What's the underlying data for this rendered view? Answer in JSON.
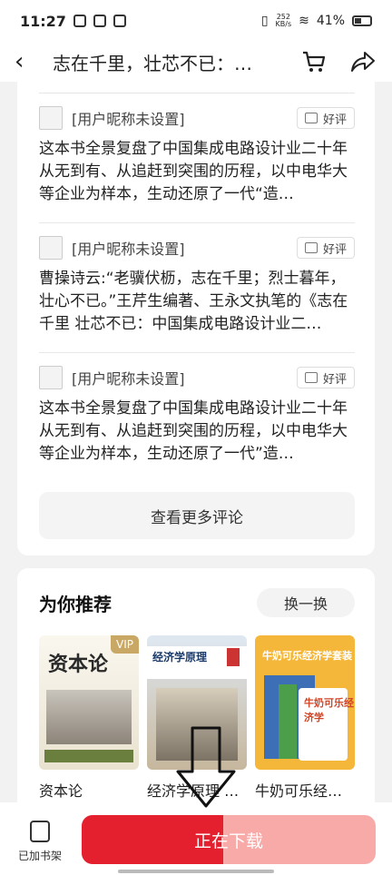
{
  "status_bar": {
    "time": "11:27",
    "net_speed_top": "252",
    "net_speed_bottom": "KB/s",
    "battery": "41%"
  },
  "nav": {
    "title": "志在千里，壮芯不已：…",
    "icons": {
      "back": "back-chevron-icon",
      "cart": "cart-icon",
      "share": "share-icon"
    }
  },
  "comments": [
    {
      "user": "[用户昵称未设置]",
      "badge": "好评",
      "text": "这本书全景复盘了中国集成电路设计业二十年从无到有、从追赶到突围的历程，以中电华大等企业为样本，生动还原了一代“造…"
    },
    {
      "user": "[用户昵称未设置]",
      "badge": "好评",
      "text": "曹操诗云:“老骥伏枥，志在千里；烈士暮年，壮心不已。”王芹生编著、王永文执笔的《志在千里 壮芯不已：中国集成电路设计业二…"
    },
    {
      "user": "[用户昵称未设置]",
      "badge": "好评",
      "text": "这本书全景复盘了中国集成电路设计业二十年从无到有、从追赶到突围的历程，以中电华大等企业为样本，生动还原了一代”造…"
    }
  ],
  "more_comments_label": "查看更多评论",
  "recommend": {
    "title": "为你推荐",
    "refresh_label": "换一换",
    "books": [
      {
        "name": "资本论",
        "cover_title": "资本论",
        "cover_badge": "VIP"
      },
      {
        "name": "经济学原理 …",
        "cover_title": "经济学原理"
      },
      {
        "name": "牛奶可乐经…",
        "cover_title": "牛奶可乐经济学套装",
        "cover_sub": "牛奶可乐经济学"
      }
    ]
  },
  "bottom": {
    "shelf_label": "已加书架",
    "download_label": "正在下载",
    "download_progress": 0.48
  },
  "colors": {
    "accent_red": "#e5202e",
    "progress_track": "#f7aaa8"
  }
}
